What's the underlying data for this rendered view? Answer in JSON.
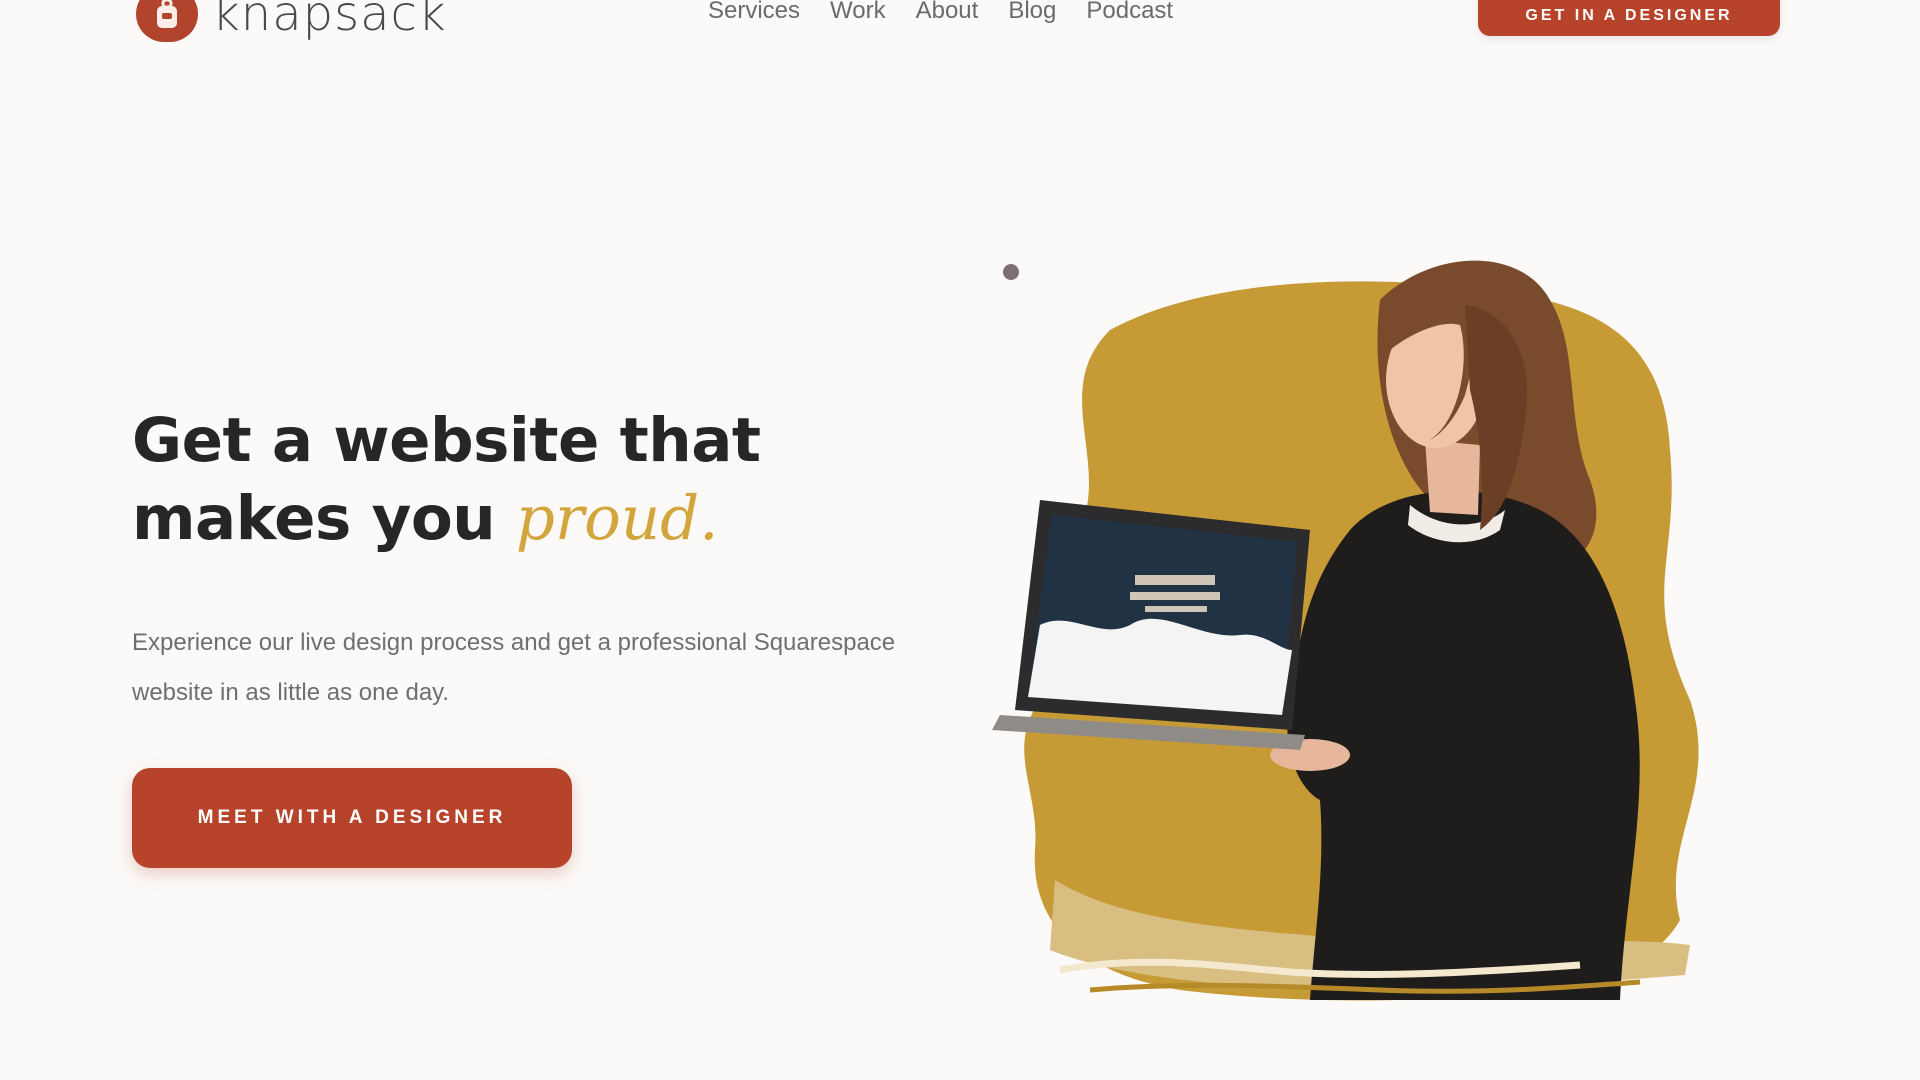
{
  "brand": {
    "name": "knapsack",
    "accent_color": "#b8432b",
    "highlight_color": "#d2a63d",
    "logo_icon": "backpack-icon"
  },
  "nav": {
    "items": [
      {
        "label": "Services"
      },
      {
        "label": "Work"
      },
      {
        "label": "About"
      },
      {
        "label": "Blog"
      },
      {
        "label": "Podcast"
      }
    ],
    "cta_label": "Get in a Designer"
  },
  "hero": {
    "title_line1": "Get a website that",
    "title_line2_prefix": "makes you ",
    "title_accent": "proud.",
    "description": "Experience our live design process and get a professional Squarespace website in as little as one day.",
    "cta_label": "Meet with a designer"
  },
  "illustration": {
    "subject": "woman holding laptop",
    "laptop_screen_color": "#203244"
  }
}
